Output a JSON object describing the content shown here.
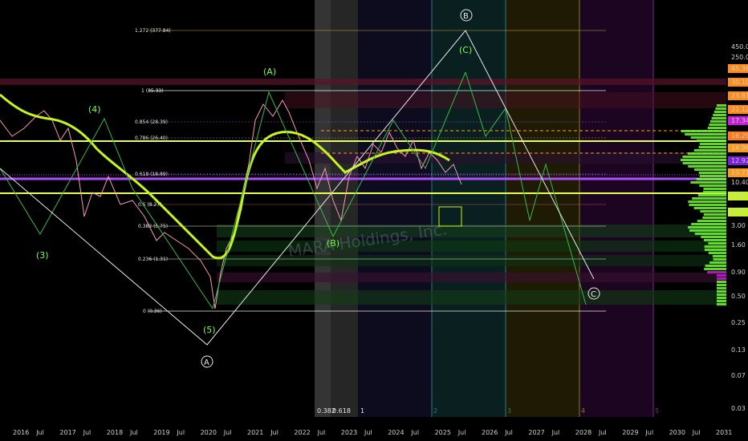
{
  "watermark": "MARA Holdings, Inc.",
  "y_axis_labels": [
    "450.00",
    "250.00",
    "45.38",
    "30.10",
    "23.81",
    "21.12",
    "17.34",
    "16.29",
    "14.96",
    "12.92",
    "10.71",
    "10.40",
    "9.62",
    "6.81",
    "3.00",
    "1.60",
    "0.90",
    "0.50",
    "0.25",
    "0.13",
    "0.07",
    "0.03"
  ],
  "x_axis_labels": [
    "2016",
    "Jul",
    "2017",
    "Jul",
    "2018",
    "Jul",
    "2019",
    "Jul",
    "2020",
    "Jul",
    "2021",
    "Jul",
    "2022",
    "Jul",
    "2023",
    "Jul",
    "2024",
    "Jul",
    "2025",
    "Jul",
    "2026",
    "Jul",
    "2027",
    "Jul",
    "2028",
    "Jul",
    "2029",
    "Jul",
    "2030",
    "Jul",
    "2031"
  ],
  "fib_labels": [
    "1.272 (377.84)",
    "1 (85.33)",
    "0.854 (28.39)",
    "0.786 (26.40)",
    "0.618 (18.89)",
    "0.5 (8.27)",
    "0.382 (5.75)",
    "0.236 (1.31)",
    "0 (0.36)"
  ],
  "time_zone_labels": [
    "0.382",
    "0.618",
    "1",
    "2",
    "3",
    "4",
    "5"
  ],
  "wave_labels": {
    "A": "(A)",
    "B": "(B)",
    "C": "(C)",
    "w3": "(3)",
    "w4": "(4)",
    "w5": "(5)",
    "circleA": "A",
    "circleB": "B",
    "circleC": "C"
  },
  "colors": {
    "ma_line": "#c6f51a",
    "hline_yellow": "#e9ff4d",
    "hline_purple": "#b24cff",
    "volume_profile": "#6cff2a",
    "wave_green": "#3cb84a",
    "price_pink": "#f49ab4"
  },
  "chart_data": {
    "type": "line",
    "title": "",
    "x": [
      "2016",
      "2017",
      "2018",
      "2019",
      "2020",
      "2021",
      "2022",
      "2023",
      "2024",
      "2025",
      "2026",
      "2027",
      "2028"
    ],
    "series": [
      {
        "values": [
          9,
          14,
          4,
          1.2,
          0.4,
          55,
          40,
          5,
          12,
          17,
          25,
          8,
          0.9
        ]
      }
    ],
    "y_scale": "log",
    "ylim": [
      0.03,
      450
    ],
    "grid": false
  }
}
